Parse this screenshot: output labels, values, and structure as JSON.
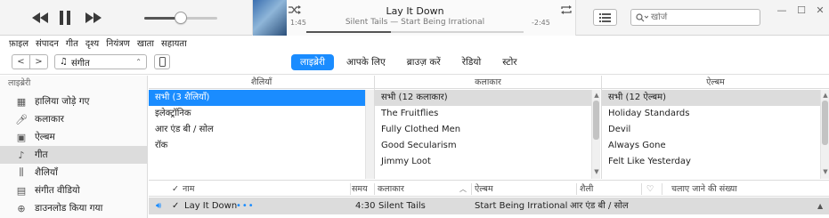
{
  "player": {
    "now_playing_title": "Lay It Down",
    "now_playing_subtitle": "Silent Tails — Start Being Irrational",
    "time_elapsed": "1:45",
    "time_remaining": "-2:45",
    "progress": 0.39,
    "volume": 0.5
  },
  "search": {
    "placeholder": "खोजें"
  },
  "menu": [
    "फ़ाइल",
    "संपादन",
    "गीत",
    "दृश्य",
    "नियंत्रण",
    "खाता",
    "सहायता"
  ],
  "nav": {
    "media_type": "संगीत",
    "tabs": [
      {
        "label": "लाइब्रेरी",
        "active": true
      },
      {
        "label": "आपके लिए",
        "active": false
      },
      {
        "label": "ब्राउज़ करें",
        "active": false
      },
      {
        "label": "रेडियो",
        "active": false
      },
      {
        "label": "स्टोर",
        "active": false
      }
    ]
  },
  "sidebar": {
    "title": "लाइब्रेरी",
    "items": [
      {
        "label": "हालिया जोड़े गए",
        "icon": "grid-icon",
        "selected": false
      },
      {
        "label": "कलाकार",
        "icon": "microphone-icon",
        "selected": false
      },
      {
        "label": "ऐल्बम",
        "icon": "album-icon",
        "selected": false
      },
      {
        "label": "गीत",
        "icon": "music-note-icon",
        "selected": true
      },
      {
        "label": "शैलियाँ",
        "icon": "genres-icon",
        "selected": false
      },
      {
        "label": "संगीत वीडियो",
        "icon": "music-video-icon",
        "selected": false
      },
      {
        "label": "डाउनलोड किया गया",
        "icon": "download-icon",
        "selected": false
      }
    ]
  },
  "browser": {
    "genres": {
      "header": "शैलियाँ",
      "items": [
        "सभी (3 शैलियाँ)",
        "इलेक्ट्रॉनिक",
        "आर एंड बी / सोल",
        "रॉक"
      ]
    },
    "artists": {
      "header": "कलाकार",
      "items": [
        "सभी (12 कलाकार)",
        "The Fruitflies",
        "Fully Clothed Men",
        "Good Secularism",
        "Jimmy Loot"
      ]
    },
    "albums": {
      "header": "ऐल्बम",
      "items": [
        "सभी (12 ऐल्बम)",
        "Holiday Standards",
        "Devil",
        "Always Gone",
        "Felt Like Yesterday"
      ]
    }
  },
  "table": {
    "headers": {
      "check": "✓",
      "name": "नाम",
      "time": "समय",
      "artist": "कलाकार",
      "album": "ऐल्बम",
      "genre": "शैली",
      "plays": "चलाए जाने की संख्या"
    },
    "rows": [
      {
        "checked": "✓",
        "name": "Lay It Down",
        "more": "•••",
        "time": "4:30",
        "artist": "Silent Tails",
        "album": "Start Being Irrational",
        "genre": "आर एंड बी / सोल"
      }
    ]
  }
}
